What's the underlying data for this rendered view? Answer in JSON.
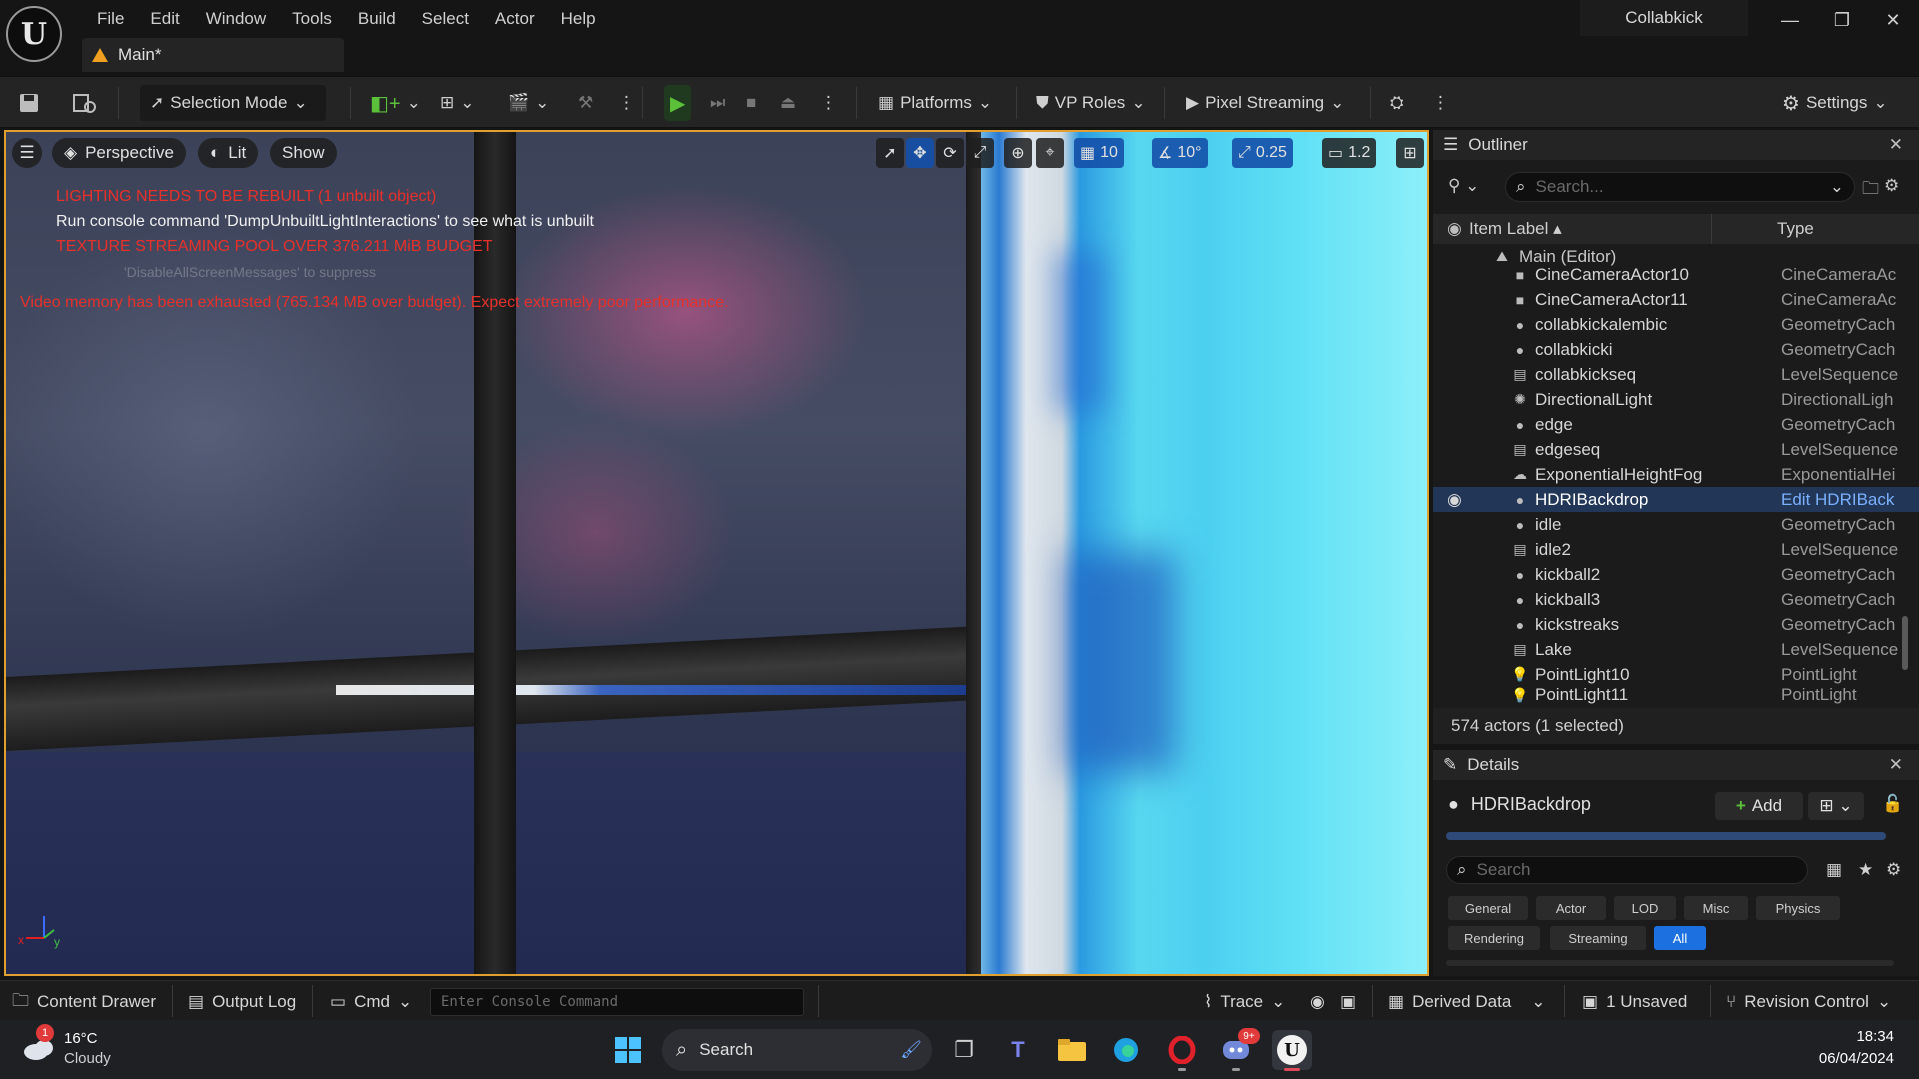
{
  "menu": [
    "File",
    "Edit",
    "Window",
    "Tools",
    "Build",
    "Select",
    "Actor",
    "Help"
  ],
  "document_tab": "Main*",
  "app_title": "Collabkick",
  "toolbar": {
    "selection_mode": "Selection Mode",
    "platforms": "Platforms",
    "vp_roles": "VP Roles",
    "pixel_streaming": "Pixel Streaming",
    "settings": "Settings"
  },
  "viewport": {
    "perspective": "Perspective",
    "lit": "Lit",
    "show": "Show",
    "grid_snap": "10",
    "rotate_snap": "10°",
    "scale_snap": "0.25",
    "camera_speed": "1.2",
    "messages": {
      "lighting": "LIGHTING NEEDS TO BE REBUILT (1 unbuilt object)",
      "console_hint": "Run console command 'DumpUnbuiltLightInteractions' to see what is unbuilt",
      "texture_pool": "TEXTURE STREAMING POOL OVER 376.211 MiB BUDGET",
      "suppress": "'DisableAllScreenMessages' to suppress",
      "video_memory": "Video memory has been exhausted (765.134 MB over budget). Expect extremely poor performance."
    }
  },
  "outliner": {
    "title": "Outliner",
    "search_placeholder": "Search...",
    "col_label": "Item Label",
    "col_type": "Type",
    "root": "Main (Editor)",
    "rows": [
      {
        "name": "CineCameraActor10",
        "type": "CineCameraAc"
      },
      {
        "name": "CineCameraActor11",
        "type": "CineCameraAc"
      },
      {
        "name": "collabkickalembic",
        "type": "GeometryCach"
      },
      {
        "name": "collabkicki",
        "type": "GeometryCach"
      },
      {
        "name": "collabkickseq",
        "type": "LevelSequence"
      },
      {
        "name": "DirectionalLight",
        "type": "DirectionalLigh"
      },
      {
        "name": "edge",
        "type": "GeometryCach"
      },
      {
        "name": "edgeseq",
        "type": "LevelSequence"
      },
      {
        "name": "ExponentialHeightFog",
        "type": "ExponentialHei"
      },
      {
        "name": "HDRIBackdrop",
        "type": "Edit HDRIBack"
      },
      {
        "name": "idle",
        "type": "GeometryCach"
      },
      {
        "name": "idle2",
        "type": "LevelSequence"
      },
      {
        "name": "kickball2",
        "type": "GeometryCach"
      },
      {
        "name": "kickball3",
        "type": "GeometryCach"
      },
      {
        "name": "kickstreaks",
        "type": "GeometryCach"
      },
      {
        "name": "Lake",
        "type": "LevelSequence"
      },
      {
        "name": "PointLight10",
        "type": "PointLight"
      },
      {
        "name": "PointLight11",
        "type": "PointLight"
      }
    ],
    "status": "574 actors (1 selected)"
  },
  "details": {
    "title": "Details",
    "actor_name": "HDRIBackdrop",
    "add": "Add",
    "search_placeholder": "Search",
    "filters": [
      "General",
      "Actor",
      "LOD",
      "Misc",
      "Physics",
      "Rendering",
      "Streaming",
      "All"
    ]
  },
  "statusbar": {
    "content_drawer": "Content Drawer",
    "output_log": "Output Log",
    "cmd": "Cmd",
    "console_placeholder": "Enter Console Command",
    "trace": "Trace",
    "derived_data": "Derived Data",
    "unsaved": "1 Unsaved",
    "revision_control": "Revision Control"
  },
  "taskbar": {
    "temperature": "16°C",
    "weather": "Cloudy",
    "weather_badge": "1",
    "search": "Search",
    "discord_badge": "9+",
    "time": "18:34",
    "date": "06/04/2024"
  },
  "colors": {
    "accent": "#1d70e0",
    "viewport_border": "#e0a030",
    "error_text": "#e8302a",
    "play_green": "#5cc13a"
  }
}
